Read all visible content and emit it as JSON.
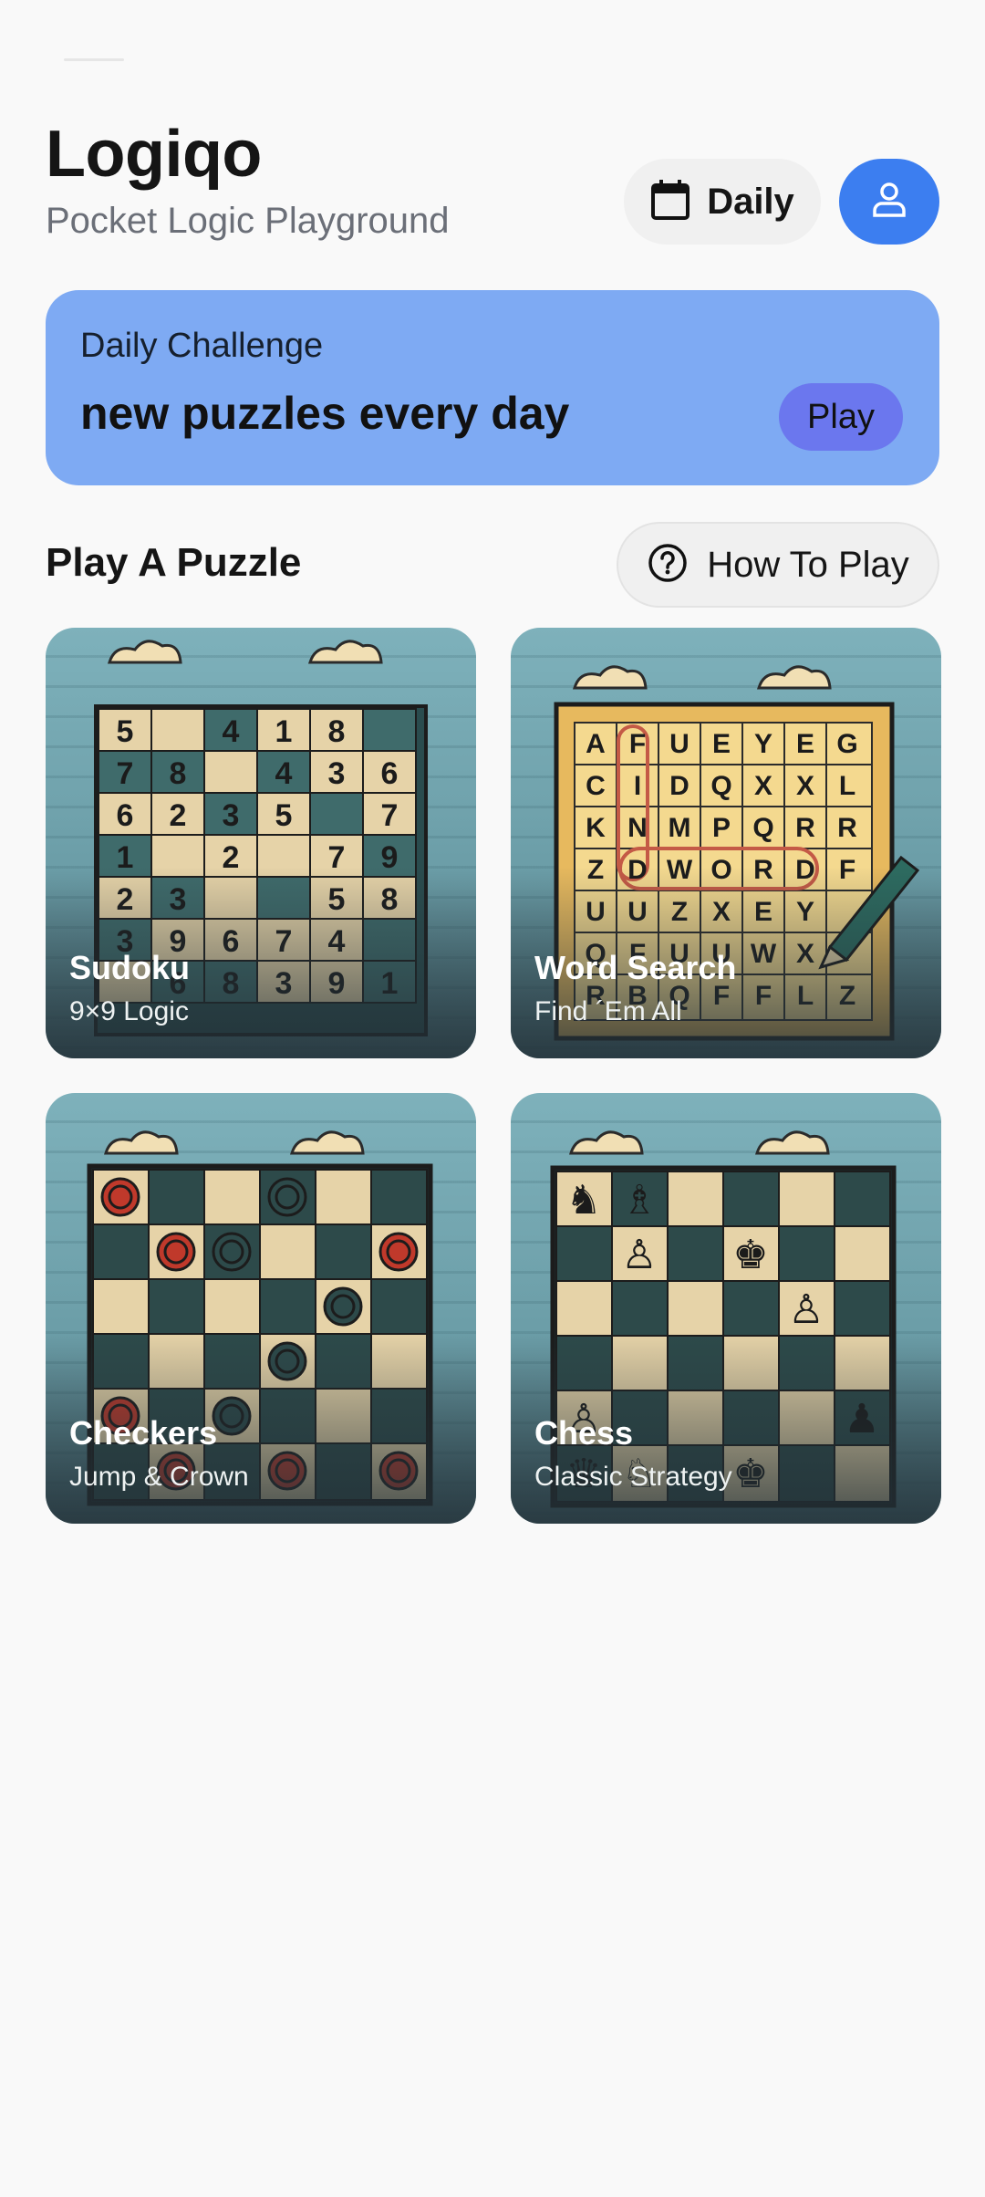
{
  "header": {
    "title": "Logiqo",
    "subtitle": "Pocket Logic Playground",
    "daily_label": "Daily",
    "daily_icon": "calendar-icon",
    "profile_icon": "user-icon"
  },
  "banner": {
    "kicker": "Daily Challenge",
    "headline": "new puzzles every day",
    "play_label": "Play"
  },
  "section": {
    "title": "Play A Puzzle",
    "howto_label": "How To Play",
    "howto_icon": "help-icon"
  },
  "cards": [
    {
      "name": "Sudoku",
      "tag": "9×9 Logic"
    },
    {
      "name": "Word Search",
      "tag": "Find ´Em All"
    },
    {
      "name": "Checkers",
      "tag": "Jump & Crown"
    },
    {
      "name": "Chess",
      "tag": "Classic Strategy"
    }
  ],
  "colors": {
    "accent": "#3c7ef0",
    "banner": "#7eaaf3",
    "play_pill": "#6b77ee"
  }
}
